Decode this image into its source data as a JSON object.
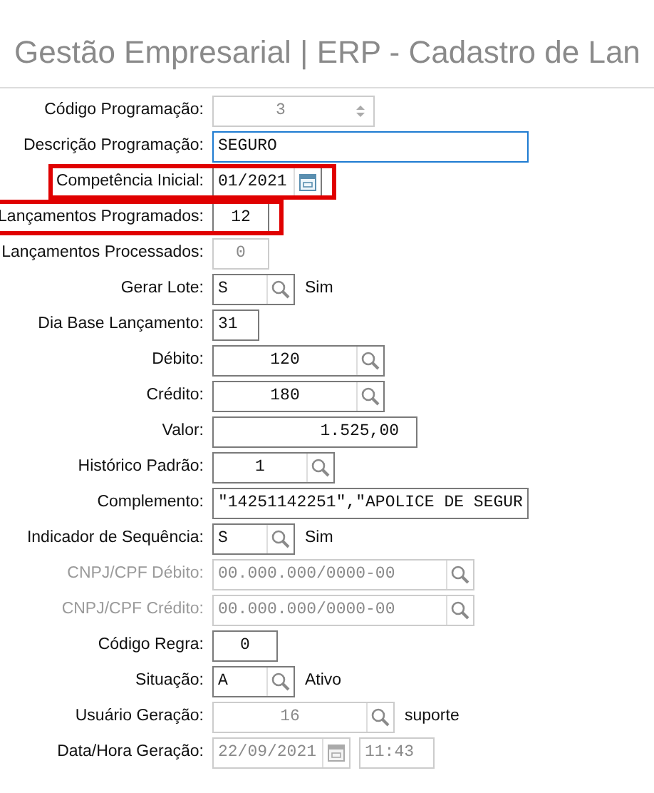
{
  "window": {
    "title": "Gestão Empresarial | ERP - Cadastro de Lan"
  },
  "fields": [
    {
      "label": "Código Programação:",
      "value": "3",
      "kind": "spinner",
      "disabled": true,
      "label_disabled": false,
      "focused": false,
      "highlighted": false
    },
    {
      "label": "Descrição Programação:",
      "value": "SEGURO",
      "kind": "text",
      "disabled": false,
      "label_disabled": false,
      "focused": true,
      "highlighted": false
    },
    {
      "label": "Competência Inicial:",
      "value": "01/2021",
      "kind": "date",
      "disabled": false,
      "label_disabled": false,
      "focused": false,
      "highlighted": true
    },
    {
      "label": "Lançamentos Programados:",
      "value": "12",
      "kind": "text",
      "disabled": false,
      "label_disabled": false,
      "focused": false,
      "highlighted": true
    },
    {
      "label": "Lançamentos Processados:",
      "value": "0",
      "kind": "text",
      "disabled": true,
      "label_disabled": false,
      "focused": false,
      "highlighted": false
    },
    {
      "label": "Gerar Lote:",
      "value": "S",
      "kind": "search",
      "disabled": false,
      "label_disabled": false,
      "focused": false,
      "highlighted": false,
      "suffix": "Sim"
    },
    {
      "label": "Dia Base Lançamento:",
      "value": "31",
      "kind": "text",
      "disabled": false,
      "label_disabled": false,
      "focused": false,
      "highlighted": false
    },
    {
      "label": "Débito:",
      "value": "120",
      "kind": "search",
      "disabled": false,
      "label_disabled": false,
      "focused": false,
      "highlighted": false
    },
    {
      "label": "Crédito:",
      "value": "180",
      "kind": "search",
      "disabled": false,
      "label_disabled": false,
      "focused": false,
      "highlighted": false
    },
    {
      "label": "Valor:",
      "value": "1.525,00",
      "kind": "text",
      "disabled": false,
      "label_disabled": false,
      "focused": false,
      "highlighted": false
    },
    {
      "label": "Histórico Padrão:",
      "value": "1",
      "kind": "search",
      "disabled": false,
      "label_disabled": false,
      "focused": false,
      "highlighted": false
    },
    {
      "label": "Complemento:",
      "value": "\"14251142251\",\"APOLICE DE SEGUR",
      "kind": "text",
      "disabled": false,
      "label_disabled": false,
      "focused": false,
      "highlighted": false
    },
    {
      "label": "Indicador de Sequência:",
      "value": "S",
      "kind": "search",
      "disabled": false,
      "label_disabled": false,
      "focused": false,
      "highlighted": false,
      "suffix": "Sim"
    },
    {
      "label": "CNPJ/CPF Débito:",
      "value": "00.000.000/0000-00",
      "kind": "search",
      "disabled": true,
      "label_disabled": true,
      "focused": false,
      "highlighted": false
    },
    {
      "label": "CNPJ/CPF Crédito:",
      "value": "00.000.000/0000-00",
      "kind": "search",
      "disabled": true,
      "label_disabled": true,
      "focused": false,
      "highlighted": false
    },
    {
      "label": "Código Regra:",
      "value": "0",
      "kind": "text",
      "disabled": false,
      "label_disabled": false,
      "focused": false,
      "highlighted": false
    },
    {
      "label": "Situação:",
      "value": "A",
      "kind": "search",
      "disabled": false,
      "label_disabled": false,
      "focused": false,
      "highlighted": false,
      "suffix": "Ativo"
    },
    {
      "label": "Usuário Geração:",
      "value": "16",
      "kind": "search",
      "disabled": true,
      "label_disabled": false,
      "focused": false,
      "highlighted": false,
      "suffix": "suporte"
    },
    {
      "label": "Data/Hora Geração:",
      "value": "22/09/2021",
      "kind": "date",
      "disabled": true,
      "label_disabled": false,
      "focused": false,
      "highlighted": false,
      "extra": "11:43"
    }
  ]
}
